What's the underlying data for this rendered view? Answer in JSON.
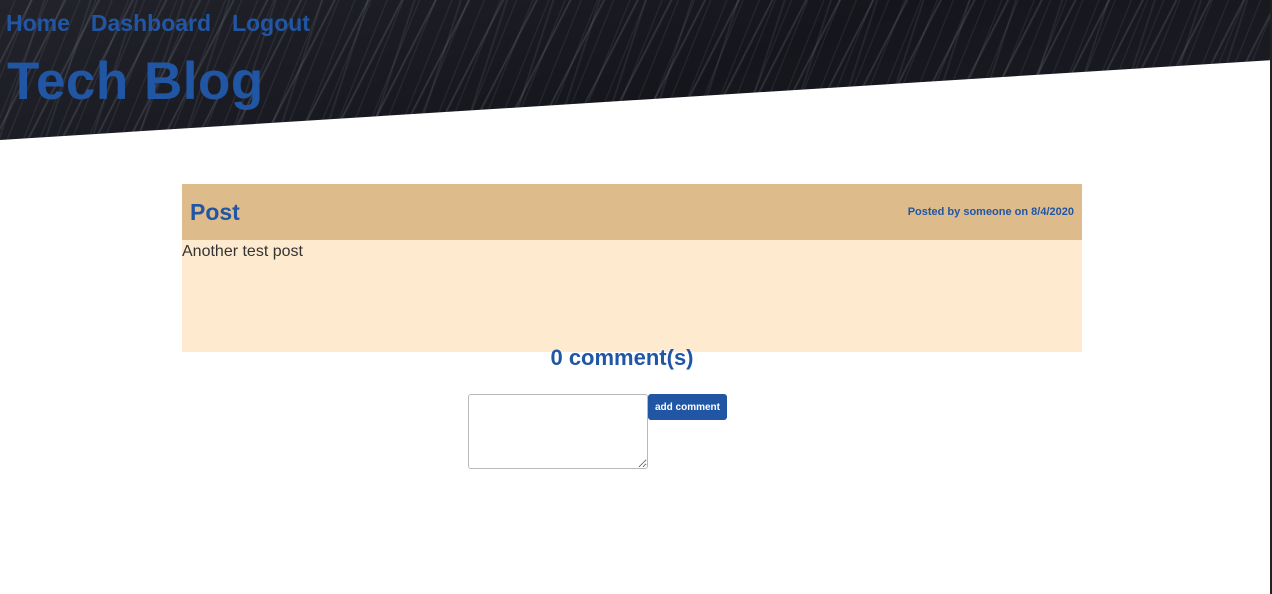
{
  "nav": {
    "items": [
      {
        "label": "Home"
      },
      {
        "label": "Dashboard"
      },
      {
        "label": "Logout"
      }
    ]
  },
  "site": {
    "title": "Tech Blog"
  },
  "post": {
    "title": "Post",
    "meta": "Posted by someone on 8/4/2020",
    "body": "Another test post"
  },
  "comments": {
    "heading": "0 comment(s)",
    "input_value": "",
    "input_placeholder": "",
    "submit_label": "add comment"
  },
  "colors": {
    "accent": "#2156a5",
    "post_header_bg": "#debb8a",
    "post_body_bg": "#feebcf",
    "header_bg": "#1b1c23"
  }
}
